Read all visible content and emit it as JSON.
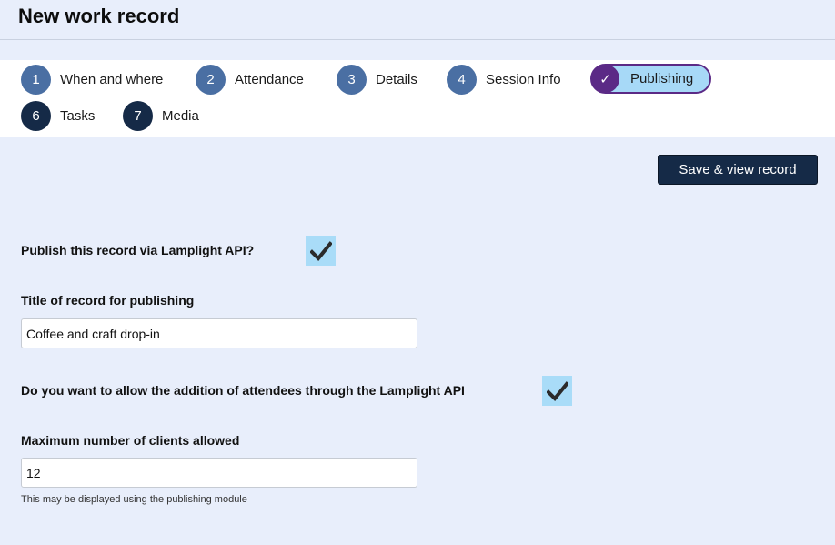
{
  "page": {
    "title": "New work record"
  },
  "steps": [
    {
      "number": "1",
      "label": "When and where"
    },
    {
      "number": "2",
      "label": "Attendance"
    },
    {
      "number": "3",
      "label": "Details"
    },
    {
      "number": "4",
      "label": "Session Info"
    },
    {
      "number": "✓",
      "label": "Publishing",
      "active": true
    },
    {
      "number": "6",
      "label": "Tasks"
    },
    {
      "number": "7",
      "label": "Media"
    }
  ],
  "actions": {
    "save_label": "Save & view record"
  },
  "form": {
    "publish_api": {
      "label": "Publish this record via Lamplight API?",
      "checked": true
    },
    "publish_title": {
      "label": "Title of record for publishing",
      "value": "Coffee and craft drop-in"
    },
    "allow_attendees": {
      "label": "Do you want to allow the addition of attendees through the Lamplight API",
      "checked": true
    },
    "max_clients": {
      "label": "Maximum number of clients allowed",
      "value": "12",
      "hint": "This may be displayed using the publishing module"
    }
  },
  "colors": {
    "background": "#e8eefb",
    "step_blue": "#4a6fa3",
    "step_dark": "#152a47",
    "active_purple": "#5b2a86",
    "active_fill": "#a7d9f7",
    "checkbox_fill": "#a9dcf8"
  },
  "icons": {
    "checkbox_checked": "checkmark-icon",
    "active_step": "check-icon"
  }
}
